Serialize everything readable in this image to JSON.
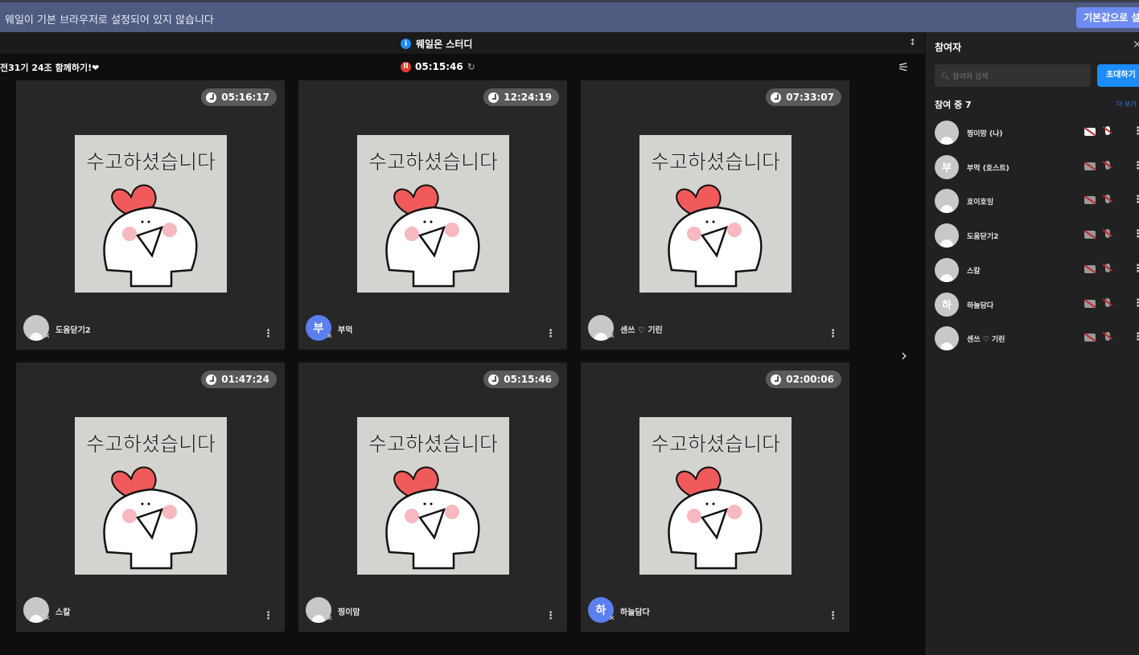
{
  "banner": {
    "message": "웨일이 기본 브라우저로 설정되어 있지 않습니다",
    "button": "기본값으로 설정"
  },
  "header": {
    "title": "웨일온 스터디",
    "group_name": "전31기 24조 함께하기!❤",
    "timer": "05:15:46",
    "sort_icon": "↕",
    "colors": {
      "info": "#1a8cff",
      "record": "#e53935"
    }
  },
  "sticker_text": "수고하셨습니다",
  "tiles": [
    {
      "time": "05:16:17",
      "name": "도움닫기2",
      "avatar": ""
    },
    {
      "time": "12:24:19",
      "name": "부먹",
      "avatar": "부"
    },
    {
      "time": "07:33:07",
      "name": "센쓰 ♡ 기린",
      "avatar": ""
    },
    {
      "time": "01:47:24",
      "name": "스칼",
      "avatar": ""
    },
    {
      "time": "05:15:46",
      "name": "찡이맘",
      "avatar": ""
    },
    {
      "time": "02:00:06",
      "name": "하늘담다",
      "avatar": "하"
    }
  ],
  "panel": {
    "title": "참여자",
    "search_placeholder": "참여자 검색",
    "invite": "초대하기",
    "count": "참여 중 7",
    "more": "더 보기",
    "participants": [
      {
        "name": "찡이맘 (나)",
        "avatar": "",
        "me": true
      },
      {
        "name": "부먹 (호스트)",
        "avatar": "부"
      },
      {
        "name": "호이호잉",
        "avatar": ""
      },
      {
        "name": "도움닫기2",
        "avatar": ""
      },
      {
        "name": "스칼",
        "avatar": ""
      },
      {
        "name": "하늘담다",
        "avatar": "하"
      },
      {
        "name": "센쓰 ♡ 기린",
        "avatar": ""
      }
    ]
  }
}
